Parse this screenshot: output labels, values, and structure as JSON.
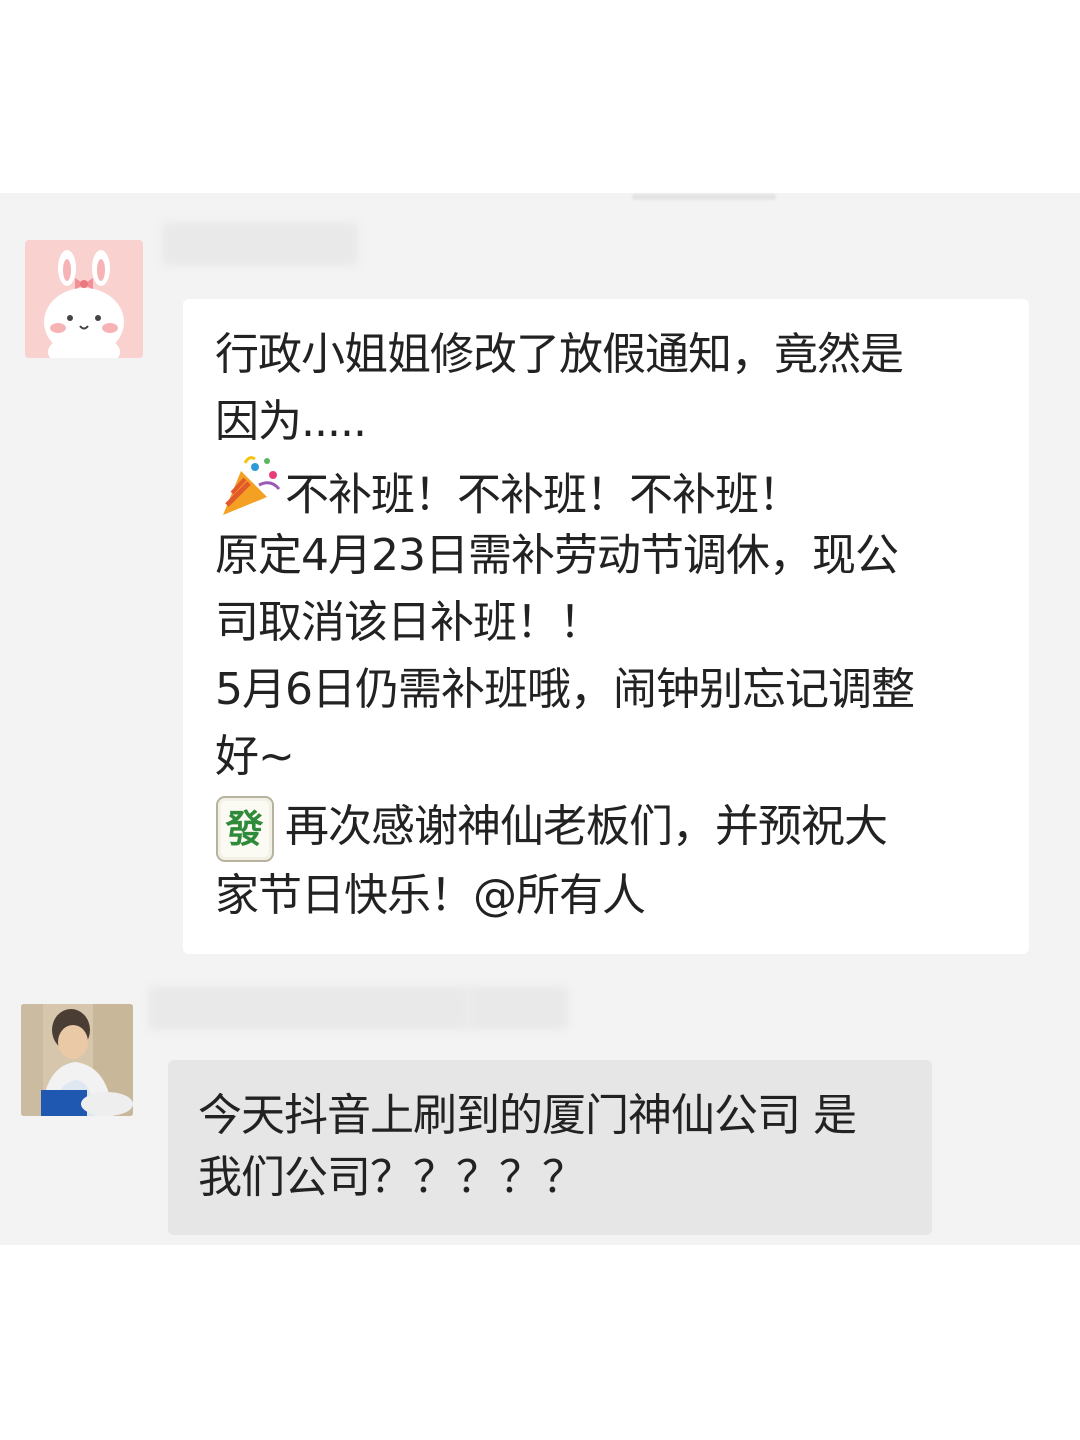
{
  "messages": [
    {
      "sender": "user-1",
      "lines": [
        "行政小姐姐修改了放假通知，竟然是",
        "因为.....",
        "不补班！不补班！不补班！",
        "原定4月23日需补劳动节调休，现公",
        "司取消该日补班！！",
        "5月6日仍需补班哦，闹钟别忘记调整",
        "好~",
        "再次感谢神仙老板们，并预祝大",
        "家节日快乐！@所有人"
      ],
      "emojis": [
        "party-popper-icon",
        "mahjong-fa-icon"
      ],
      "mahjong_char": "發"
    },
    {
      "sender": "user-2",
      "lines": [
        "今天抖音上刷到的厦门神仙公司 是",
        "我们公司？？？？？"
      ]
    }
  ],
  "colors": {
    "chat_background": "#f3f3f3",
    "incoming_bubble": "#ffffff",
    "quoted_bubble": "#e6e6e6",
    "text": "#222222",
    "mahjong_green": "#2f8a3a"
  }
}
